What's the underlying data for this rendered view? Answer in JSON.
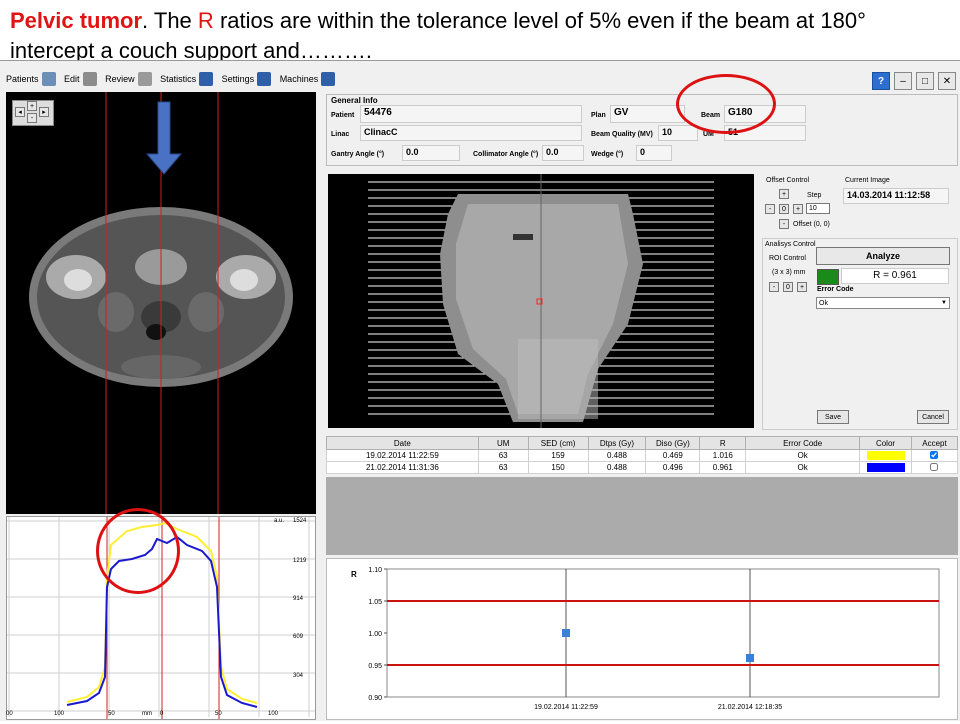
{
  "slide": {
    "title_bold": "Pelvic tumor",
    "title_p1": ". The",
    "title_r": "R",
    "title_p2": "ratios  are within the tolerance level of 5%  even if the beam at 180° intercept  a  couch support     and………."
  },
  "menu": {
    "patients": "Patients",
    "edit": "Edit",
    "review": "Review",
    "statistics": "Statistics",
    "settings": "Settings",
    "machines": "Machines"
  },
  "general_info": {
    "header": "General Info",
    "patient_label": "Patient",
    "patient_value": "54476",
    "plan_label": "Plan",
    "plan_value": "GV",
    "beam_label": "Beam",
    "beam_value": "G180",
    "linac_label": "Linac",
    "linac_value": "ClinacC",
    "beam_quality_label": "Beam Quality (MV)",
    "beam_quality_value": "10",
    "um_label": "UM",
    "um_value": "51",
    "gantry_label": "Gantry Angle (°)",
    "gantry_value": "0.0",
    "collimator_label": "Collimator Angle (°)",
    "collimator_value": "0.0",
    "wedge_label": "Wedge (°)",
    "wedge_value": "0"
  },
  "offset_control": {
    "header": "Offset Control",
    "step_label": "Step",
    "zero": "0",
    "step_value": "10",
    "offset_label": "Offset (0, 0)"
  },
  "current_image": {
    "header": "Current Image",
    "value": "14.03.2014 11:12:58"
  },
  "analysis": {
    "header": "Analisys Control",
    "roi_label": "ROI Control",
    "roi_size": "(3 x 3) mm",
    "zero": "0",
    "analyze_button": "Analyze",
    "r_value": "R = 0.961",
    "result_color": "#1a8a1a",
    "error_code_label": "Error Code",
    "error_code_value": "Ok",
    "save_button": "Save",
    "cancel_button": "Cancel"
  },
  "table": {
    "headers": [
      "Date",
      "UM",
      "SED (cm)",
      "Dtps (Gy)",
      "Diso (Gy)",
      "R",
      "Error Code",
      "Color",
      "Accept"
    ],
    "rows": [
      {
        "date": "19.02.2014 11:22:59",
        "um": "63",
        "sed": "159",
        "dtps": "0.488",
        "diso": "0.469",
        "r": "1.016",
        "error": "Ok",
        "color": "#ffff00",
        "accept": true
      },
      {
        "date": "21.02.2014 11:31:36",
        "um": "63",
        "sed": "150",
        "dtps": "0.488",
        "diso": "0.496",
        "r": "0.961",
        "error": "Ok",
        "color": "#0000ff",
        "accept": false
      }
    ]
  },
  "profile": {
    "unit_label": "a.u.",
    "y_ticks": [
      "1524",
      "1219",
      "914",
      "609",
      "304"
    ],
    "x_ticks": [
      "00",
      "100",
      "50",
      "mm",
      "0",
      "50",
      "100"
    ],
    "series_colors": [
      "#ffee33",
      "#1a1acc"
    ]
  },
  "chart_data": {
    "type": "scatter",
    "ylabel": "R",
    "ylim": [
      0.9,
      1.1
    ],
    "y_ticks": [
      "1.10",
      "1.05",
      "1.00",
      "0.95",
      "0.90"
    ],
    "x_ticks": [
      "19.02.2014 11:22:59",
      "21.02.2014 12:18:35"
    ],
    "points": [
      {
        "x": "19.02.2014 11:22:59",
        "y": 1.0
      },
      {
        "x": "21.02.2014 12:18:35",
        "y": 0.961
      }
    ],
    "tolerance_lines": [
      1.05,
      0.95
    ],
    "point_color": "#3a7fd9",
    "line_color": "#cc1111"
  }
}
